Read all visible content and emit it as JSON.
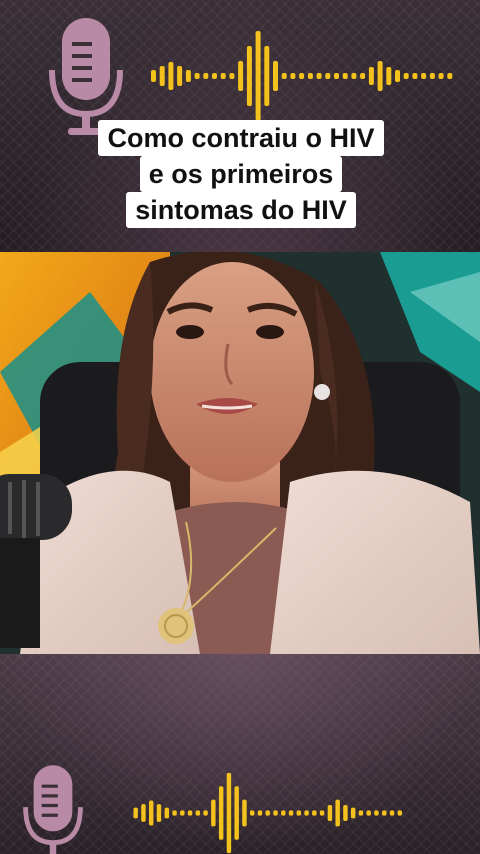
{
  "caption": {
    "line1": "Como contraiu o HIV",
    "line2": "e os primeiros",
    "line3": "sintomas do HIV"
  },
  "icons": {
    "top_mic": "microphone-icon",
    "bottom_mic": "microphone-icon",
    "waveform": "sound-wave-icon"
  },
  "colors": {
    "mic_color": "#b98aa6",
    "wave_color": "#f3c21d",
    "caption_bg": "#ffffff",
    "caption_text": "#111111"
  }
}
